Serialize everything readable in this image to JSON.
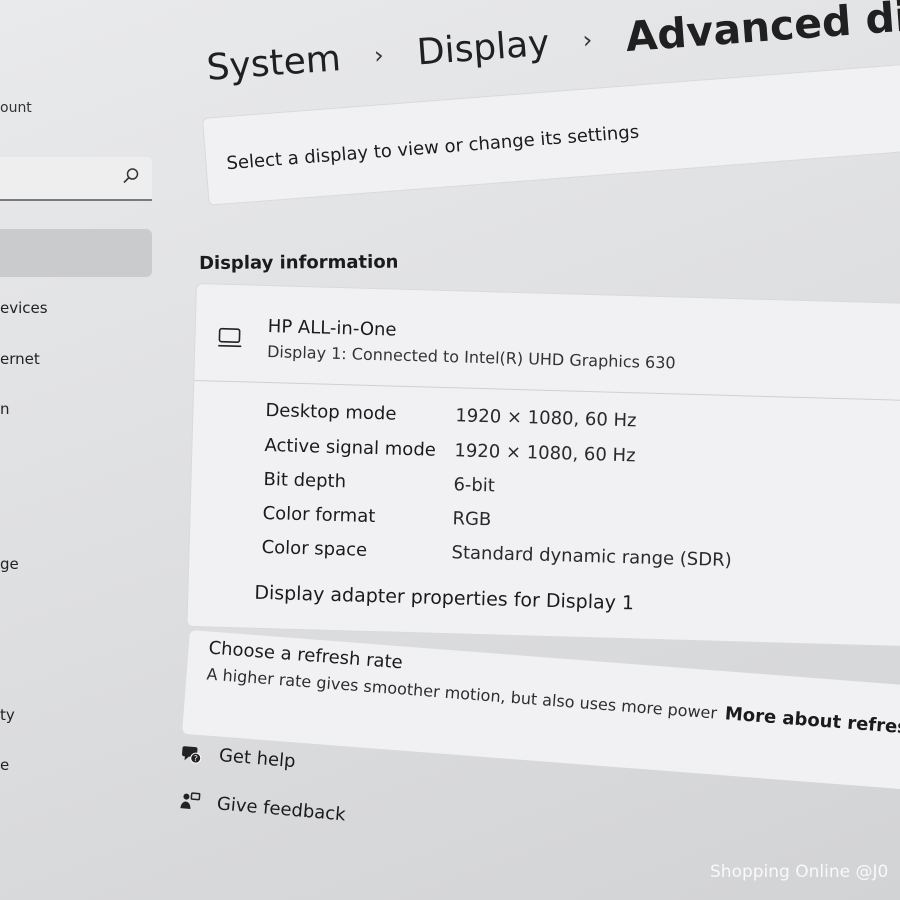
{
  "sidebar": {
    "account_fragment": "ount",
    "search": {
      "value": "",
      "placeholder": ""
    },
    "items": [
      "evices",
      "ernet",
      "n",
      "ge",
      "ty",
      "e"
    ]
  },
  "breadcrumb": {
    "items": [
      "System",
      "Display",
      "Advanced displa"
    ],
    "separator": "›"
  },
  "select_display": {
    "text": "Select a display to view or change its settings"
  },
  "display_information": {
    "title": "Display information",
    "display_name": "HP ALL-in-One",
    "display_sub": "Display 1: Connected to Intel(R) UHD Graphics 630",
    "rows": [
      {
        "label": "Desktop mode",
        "value": "1920 × 1080, 60 Hz"
      },
      {
        "label": "Active signal mode",
        "value": "1920 × 1080, 60 Hz"
      },
      {
        "label": "Bit depth",
        "value": "6-bit"
      },
      {
        "label": "Color format",
        "value": "RGB"
      },
      {
        "label": "Color space",
        "value": "Standard dynamic range (SDR)"
      }
    ],
    "adapter_link": "Display adapter properties for Display 1"
  },
  "refresh_rate": {
    "title": "Choose a refresh rate",
    "description": "A higher rate gives smoother motion, but also uses more power",
    "link": "More about refresh r"
  },
  "footer": {
    "help": "Get help",
    "feedback": "Give feedback"
  },
  "watermark": "Shopping Online @J0"
}
